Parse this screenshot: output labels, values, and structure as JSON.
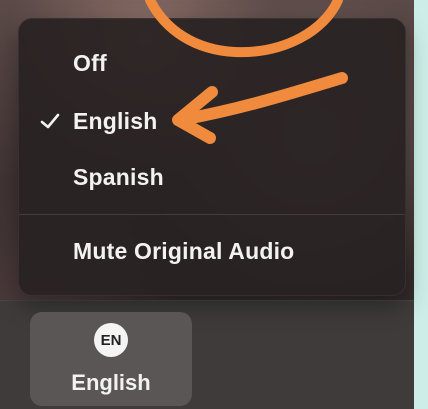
{
  "captions_menu": {
    "items": [
      {
        "label": "Off",
        "selected": false
      },
      {
        "label": "English",
        "selected": true
      },
      {
        "label": "Spanish",
        "selected": false
      }
    ],
    "mute_label": "Mute Original Audio"
  },
  "language_button": {
    "badge": "EN",
    "label": "English"
  },
  "annotation": {
    "color": "#f08a3c"
  },
  "icons": {
    "selected_check": "checkmark-icon"
  }
}
